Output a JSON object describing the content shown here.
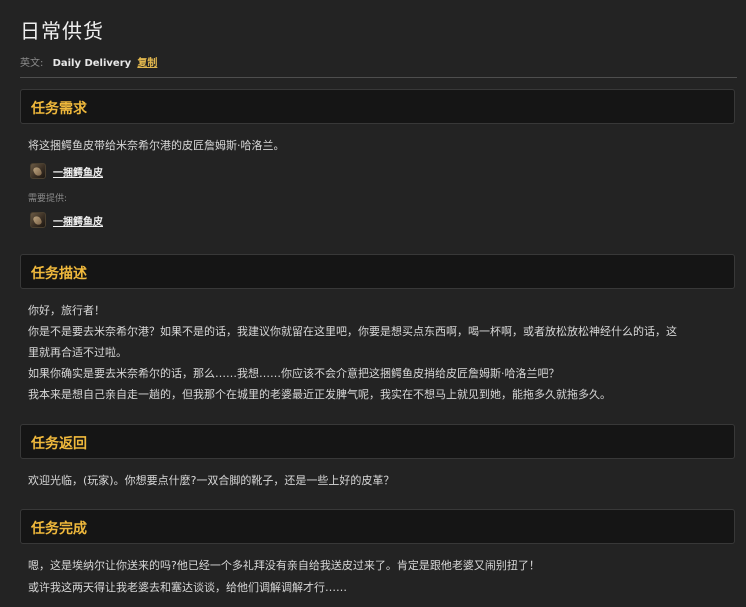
{
  "page": {
    "title": "日常供货",
    "english_label": "英文:",
    "english_name": "Daily Delivery",
    "copy_label": "复制"
  },
  "sections": {
    "requirements": {
      "heading": "任务需求",
      "text": "将这捆鳄鱼皮带给米奈希尔港的皮匠詹姆斯·哈洛兰。",
      "item_label": "一捆鳄鱼皮",
      "provided_label": "需要提供:",
      "provided_item_label": "一捆鳄鱼皮",
      "item_icon": "crocolisk-skin-icon"
    },
    "description": {
      "heading": "任务描述",
      "lines": [
        "你好，旅行者！",
        "你是不是要去米奈希尔港？如果不是的话，我建议你就留在这里吧，你要是想买点东西啊，喝一杯啊，或者放松放松神经什么的话，这",
        "里就再合适不过啦。",
        "如果你确实是要去米奈希尔的话，那么……我想……你应该不会介意把这捆鳄鱼皮捎给皮匠詹姆斯·哈洛兰吧？",
        "我本来是想自己亲自走一趟的，但我那个在城里的老婆最近正发脾气呢，我实在不想马上就见到她，能拖多久就拖多久。"
      ]
    },
    "progress": {
      "heading": "任务返回",
      "text": "欢迎光临，(玩家)。你想要点什麼?一双合脚的靴子，还是一些上好的皮革？"
    },
    "completion": {
      "heading": "任务完成",
      "lines": [
        "嗯，这是埃纳尔让你送来的吗?他已经一个多礼拜没有亲自给我送皮过来了。肯定是跟他老婆又闹别扭了！",
        "或许我这两天得让我老婆去和塞达谈谈，给他们调解调解才行……"
      ]
    }
  },
  "colors": {
    "background": "#232323",
    "header_bg": "#151515",
    "heading_gold": "#f0b93c",
    "copy_link": "#e0b64e"
  }
}
